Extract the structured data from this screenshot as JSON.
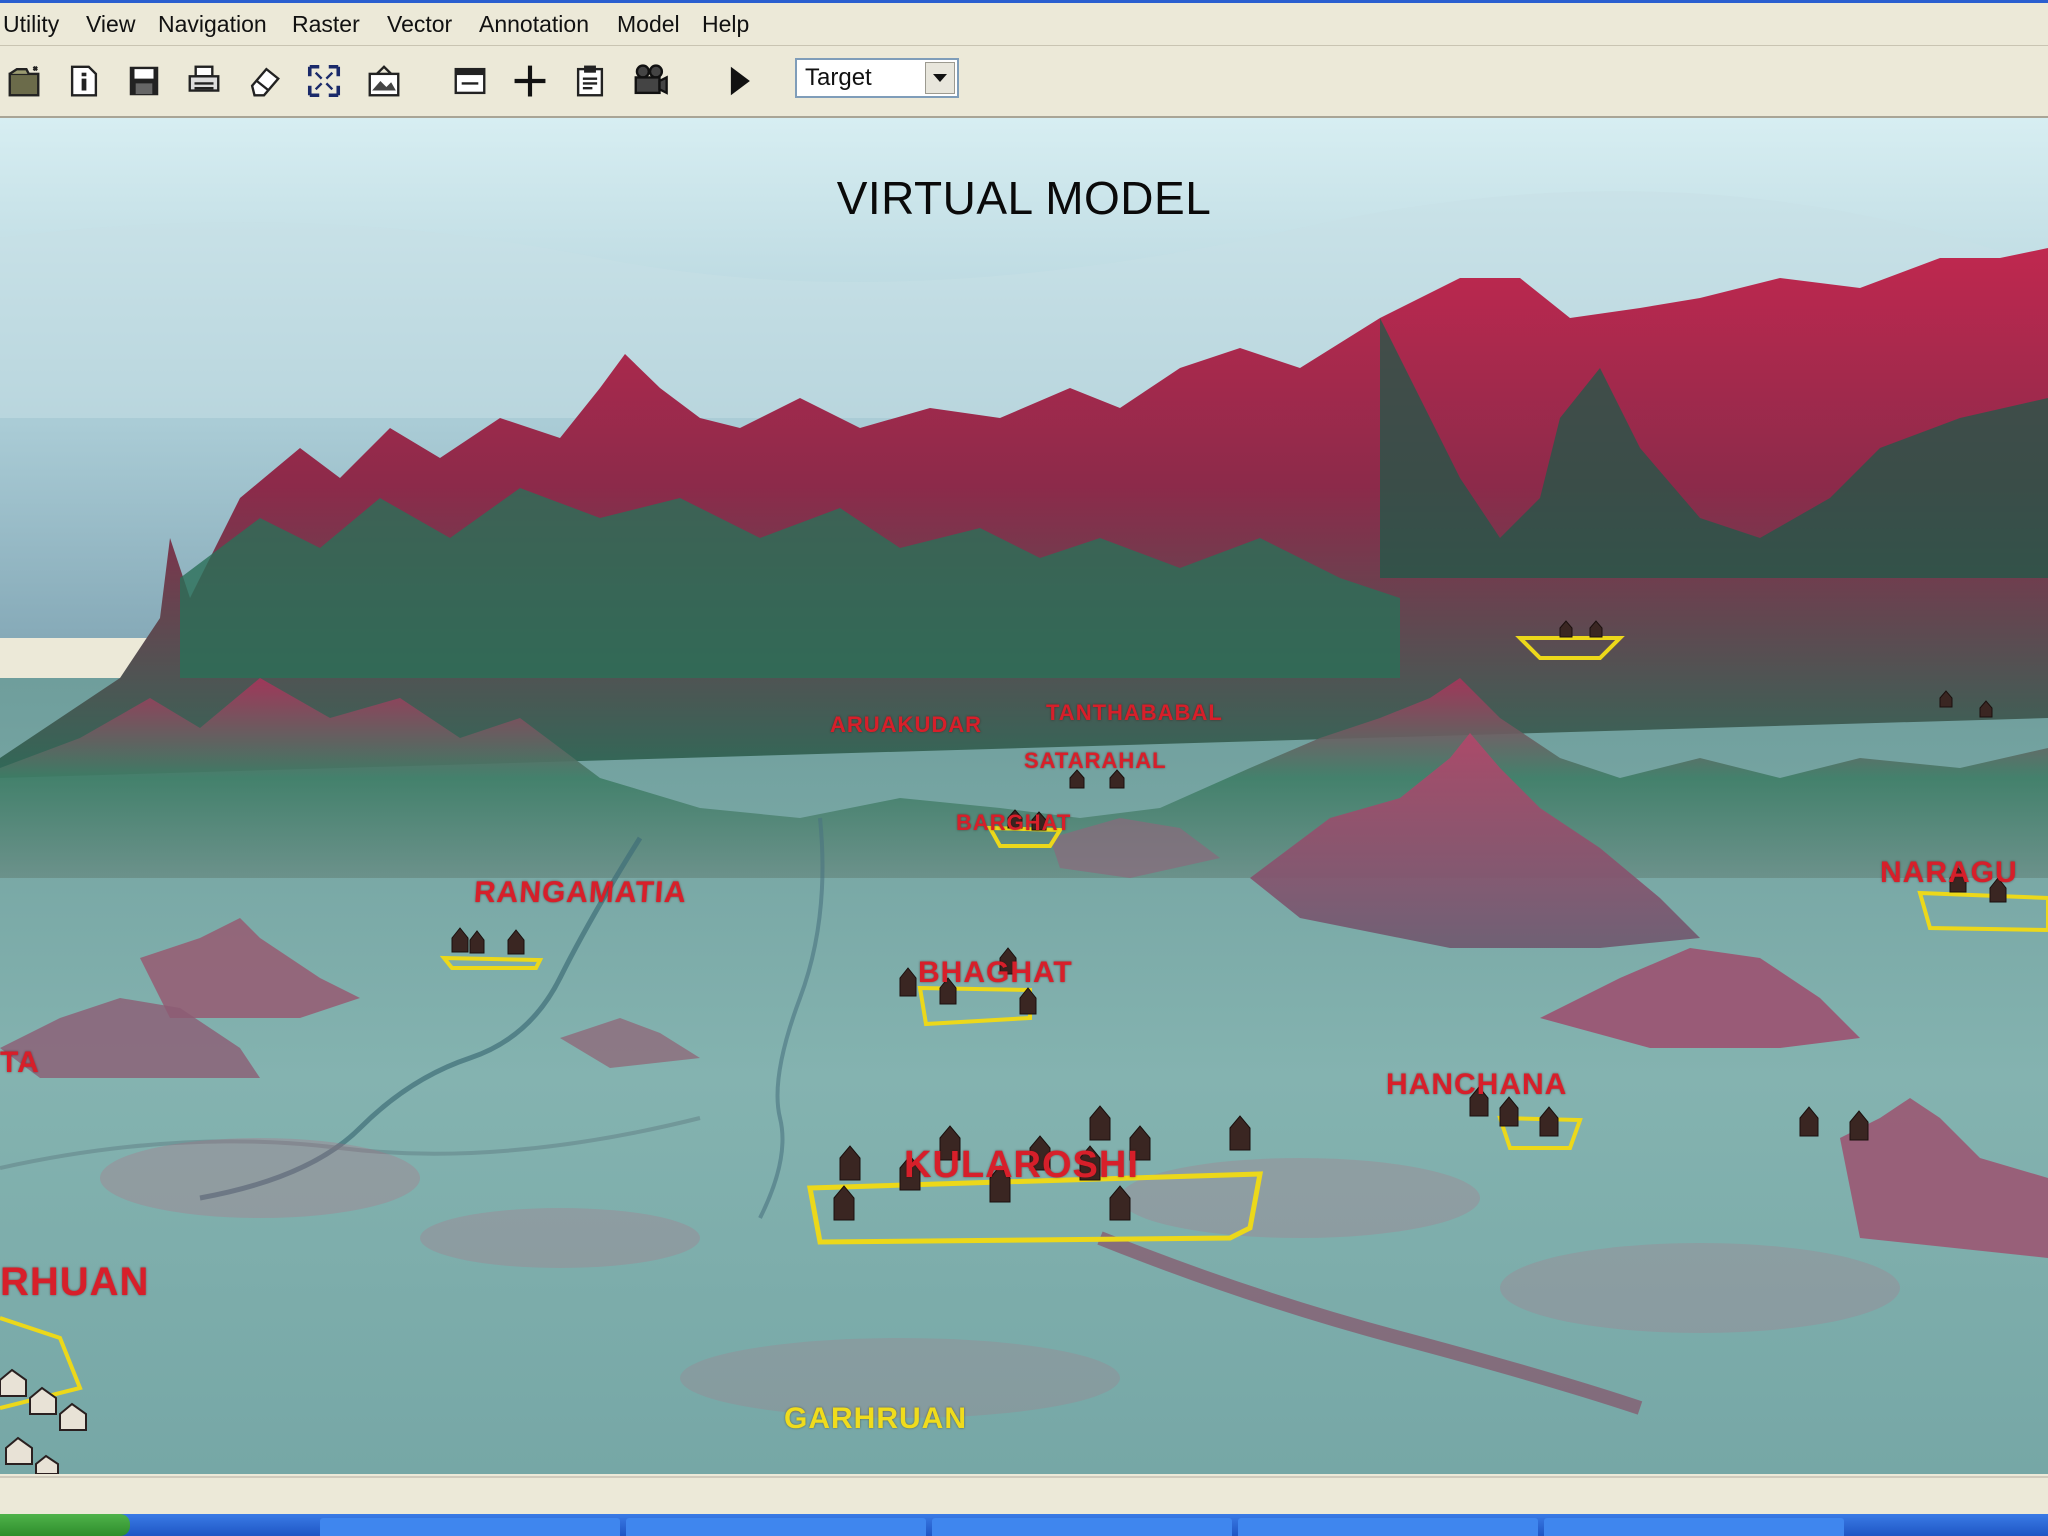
{
  "menu": [
    "Utility",
    "View",
    "Navigation",
    "Raster",
    "Vector",
    "Annotation",
    "Model",
    "Help"
  ],
  "toolbar": {
    "icons": [
      "open-icon",
      "info-icon",
      "save-icon",
      "print-icon",
      "eraser-icon",
      "fit-to-window-icon",
      "image-layer-icon",
      "window-icon",
      "add-icon",
      "clipboard-icon",
      "camera-icon",
      "play-icon"
    ],
    "target_select": "Target"
  },
  "viewer": {
    "title": "VIRTUAL MODEL",
    "places": {
      "rangamatia": "RANGAMATIA",
      "bhaghat": "BHAGHAT",
      "kuldaroshi": "KULAROSHI",
      "hanchana": "HANCHANA",
      "garhruan": "GARHRUAN",
      "rhuan_left": "RHUAN",
      "ta_left": "TA",
      "aruakudar": "ARUAKUDAR",
      "tanthababal": "TANTHABABAL",
      "satarahal": "SATARAHAL",
      "barghat": "BARGHAT",
      "naragu": "NARAGU"
    }
  },
  "colors": {
    "sky_top": "#bcdde4",
    "sky_bottom": "#8fb4c2",
    "mountain_red": "#b52050",
    "mountain_green": "#1f6b55",
    "plain_teal": "#7dada9",
    "label_red": "#d71f2a",
    "label_yellow": "#f0dc1c",
    "boundary_yellow": "#ecd81a"
  }
}
